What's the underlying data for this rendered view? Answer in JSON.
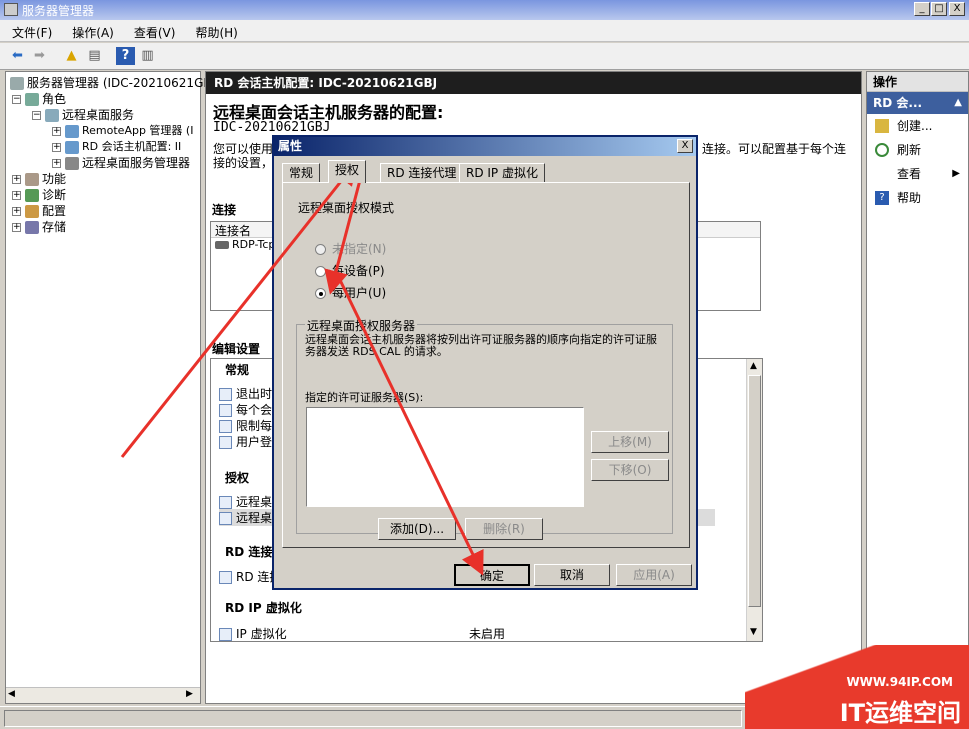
{
  "window": {
    "title": "服务器管理器",
    "btn_min": "_",
    "btn_max": "□",
    "btn_close": "X"
  },
  "menu": [
    "文件(F)",
    "操作(A)",
    "查看(V)",
    "帮助(H)"
  ],
  "tree": {
    "root": "服务器管理器 (IDC-20210621GB",
    "roles": "角色",
    "rds": "远程桌面服务",
    "remoteapp": "RemoteApp 管理器 (I",
    "rdconfig": "RD 会话主机配置: II",
    "rdsmgr": "远程桌面服务管理器",
    "features": "功能",
    "diagnostics": "诊断",
    "config": "配置",
    "storage": "存储"
  },
  "center": {
    "header": "RD 会话主机配置: IDC-20210621GBJ",
    "title": "远程桌面会话主机服务器的配置:",
    "server": "IDC-20210621GBJ",
    "desc1": "您可以使用",
    "desc1_tail": "连接。可以配置基于每个连",
    "desc2": "接的设置，",
    "connections_label": "连接",
    "conn_col": "连接名",
    "conn_row": "RDP-Tcp",
    "edit_label": "编辑设置",
    "general": "常规",
    "g_items": [
      "退出时删",
      "每个会话",
      "限制每个",
      "用户登录"
    ],
    "licensing": "授权",
    "l_items": [
      "远程桌面",
      "远程桌面"
    ],
    "rdconn": "RD 连接",
    "rdconn_item": "RD 连接",
    "ipv": "RD IP 虚拟化",
    "ipv_item": "IP 虚拟化",
    "ipv_status": "未启用"
  },
  "actions": {
    "header": "操作",
    "sub": "RD 会...",
    "items": [
      "创建...",
      "刷新",
      "查看",
      "帮助"
    ]
  },
  "dialog": {
    "title": "属性",
    "close": "X",
    "tabs": [
      "常规",
      "授权",
      "RD 连接代理",
      "RD IP 虚拟化"
    ],
    "mode_label": "远程桌面授权模式",
    "radio_unspecified": "未指定(N)",
    "radio_device": "每设备(P)",
    "radio_user": "每用户(U)",
    "group_label": "远程桌面授权服务器",
    "group_desc": "远程桌面会话主机服务器将按列出许可证服务器的顺序向指定的许可证服务器发送 RDS CAL 的请求。",
    "list_label": "指定的许可证服务器(S):",
    "btn_up": "上移(M)",
    "btn_down": "下移(O)",
    "btn_add": "添加(D)...",
    "btn_remove": "删除(R)",
    "btn_ok": "确定",
    "btn_cancel": "取消",
    "btn_apply": "应用(A)"
  },
  "watermark": {
    "url": "WWW.94IP.COM",
    "brand": "IT运维空间"
  },
  "colors": {
    "accent": "#0a246a",
    "arrow": "#e8312a",
    "header": "#1e1e1e"
  }
}
